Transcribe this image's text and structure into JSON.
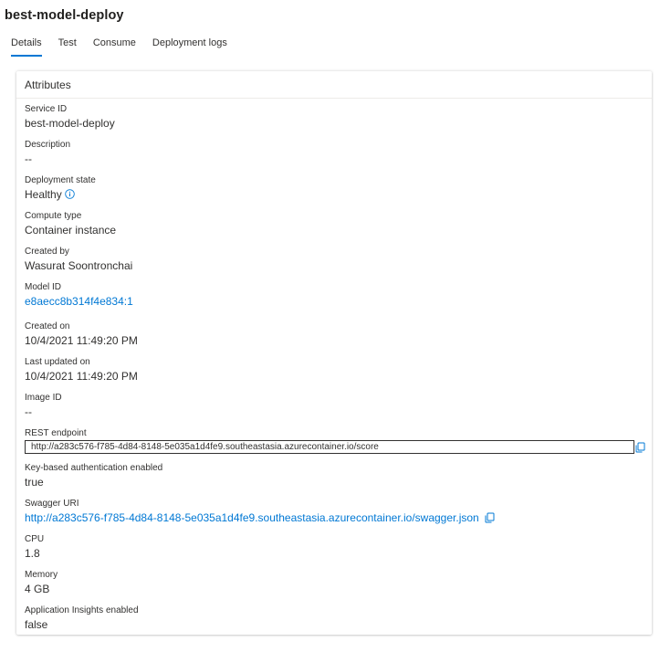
{
  "page": {
    "title": "best-model-deploy"
  },
  "tabs": [
    {
      "label": "Details",
      "active": true
    },
    {
      "label": "Test",
      "active": false
    },
    {
      "label": "Consume",
      "active": false
    },
    {
      "label": "Deployment logs",
      "active": false
    }
  ],
  "attributes": {
    "header": "Attributes",
    "service_id": {
      "label": "Service ID",
      "value": "best-model-deploy"
    },
    "description": {
      "label": "Description",
      "value": "--"
    },
    "deployment_state": {
      "label": "Deployment state",
      "value": "Healthy",
      "icon": "info-icon"
    },
    "compute_type": {
      "label": "Compute type",
      "value": "Container instance"
    },
    "created_by": {
      "label": "Created by",
      "value": "Wasurat Soontronchai"
    },
    "model_id": {
      "label": "Model ID",
      "value": "e8aecc8b314f4e834:1"
    },
    "created_on": {
      "label": "Created on",
      "value": "10/4/2021 11:49:20 PM"
    },
    "last_updated_on": {
      "label": "Last updated on",
      "value": "10/4/2021 11:49:20 PM"
    },
    "image_id": {
      "label": "Image ID",
      "value": "--"
    },
    "rest_endpoint": {
      "label": "REST endpoint",
      "value": "http://a283c576-f785-4d84-8148-5e035a1d4fe9.southeastasia.azurecontainer.io/score",
      "icon": "copy-icon"
    },
    "key_auth": {
      "label": "Key-based authentication enabled",
      "value": "true"
    },
    "swagger_uri": {
      "label": "Swagger URI",
      "value": "http://a283c576-f785-4d84-8148-5e035a1d4fe9.southeastasia.azurecontainer.io/swagger.json",
      "icon": "copy-icon"
    },
    "cpu": {
      "label": "CPU",
      "value": "1.8"
    },
    "memory": {
      "label": "Memory",
      "value": "4 GB"
    },
    "app_insights": {
      "label": "Application Insights enabled",
      "value": "false"
    }
  },
  "colors": {
    "accent": "#0078d4",
    "text": "#323130"
  }
}
